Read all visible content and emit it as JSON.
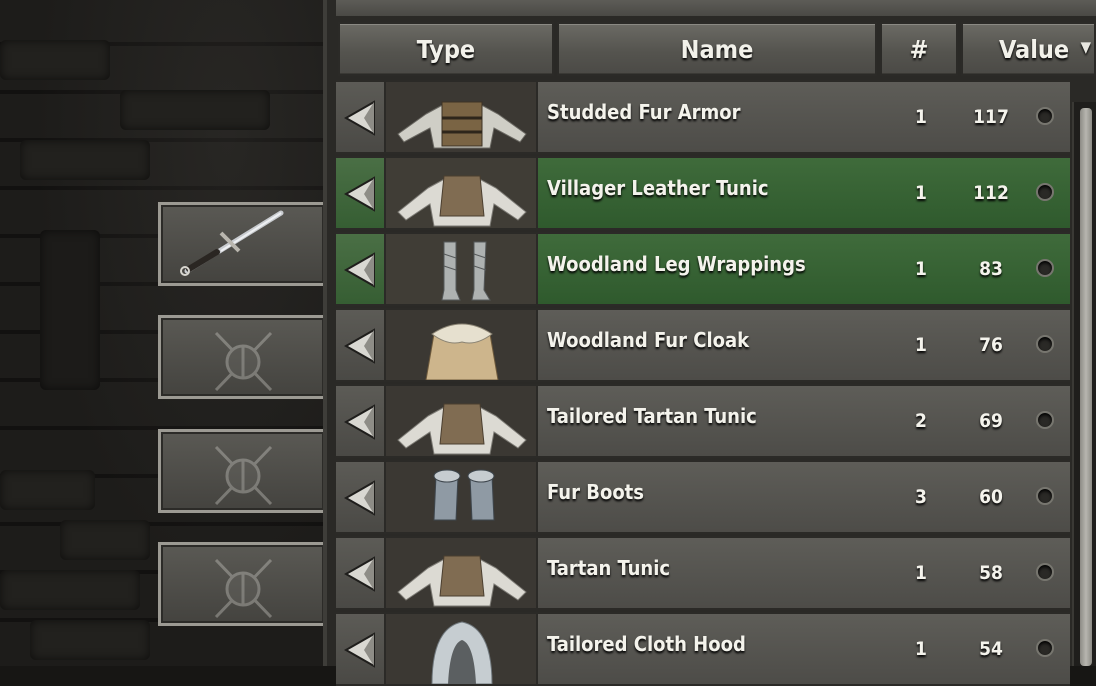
{
  "columns": {
    "type": "Type",
    "name": "Name",
    "count": "#",
    "value": "Value"
  },
  "sort_icon": "triangle-down-icon",
  "equipment_slots": [
    {
      "icon": "sword-icon",
      "filled": true
    },
    {
      "icon": "empty-shield-slot-icon",
      "filled": false
    },
    {
      "icon": "empty-shield-slot-icon",
      "filled": false
    },
    {
      "icon": "empty-shield-slot-icon",
      "filled": false
    }
  ],
  "items": [
    {
      "name": "Studded Fur Armor",
      "qty": "1",
      "value": "117",
      "selected": false,
      "icon": "armor-icon"
    },
    {
      "name": "Villager Leather Tunic",
      "qty": "1",
      "value": "112",
      "selected": true,
      "icon": "tunic-icon"
    },
    {
      "name": "Woodland Leg Wrappings",
      "qty": "1",
      "value": "83",
      "selected": true,
      "icon": "leg-wrappings-icon"
    },
    {
      "name": "Woodland Fur Cloak",
      "qty": "1",
      "value": "76",
      "selected": false,
      "icon": "cloak-icon"
    },
    {
      "name": "Tailored Tartan Tunic",
      "qty": "2",
      "value": "69",
      "selected": false,
      "icon": "tunic-icon"
    },
    {
      "name": "Fur Boots",
      "qty": "3",
      "value": "60",
      "selected": false,
      "icon": "boots-icon"
    },
    {
      "name": "Tartan Tunic",
      "qty": "1",
      "value": "58",
      "selected": false,
      "icon": "tunic-icon"
    },
    {
      "name": "Tailored Cloth Hood",
      "qty": "1",
      "value": "54",
      "selected": false,
      "icon": "hood-icon"
    }
  ],
  "colors": {
    "selected_row": "#346232",
    "row": "#55544f",
    "text": "#f4f3ec"
  }
}
